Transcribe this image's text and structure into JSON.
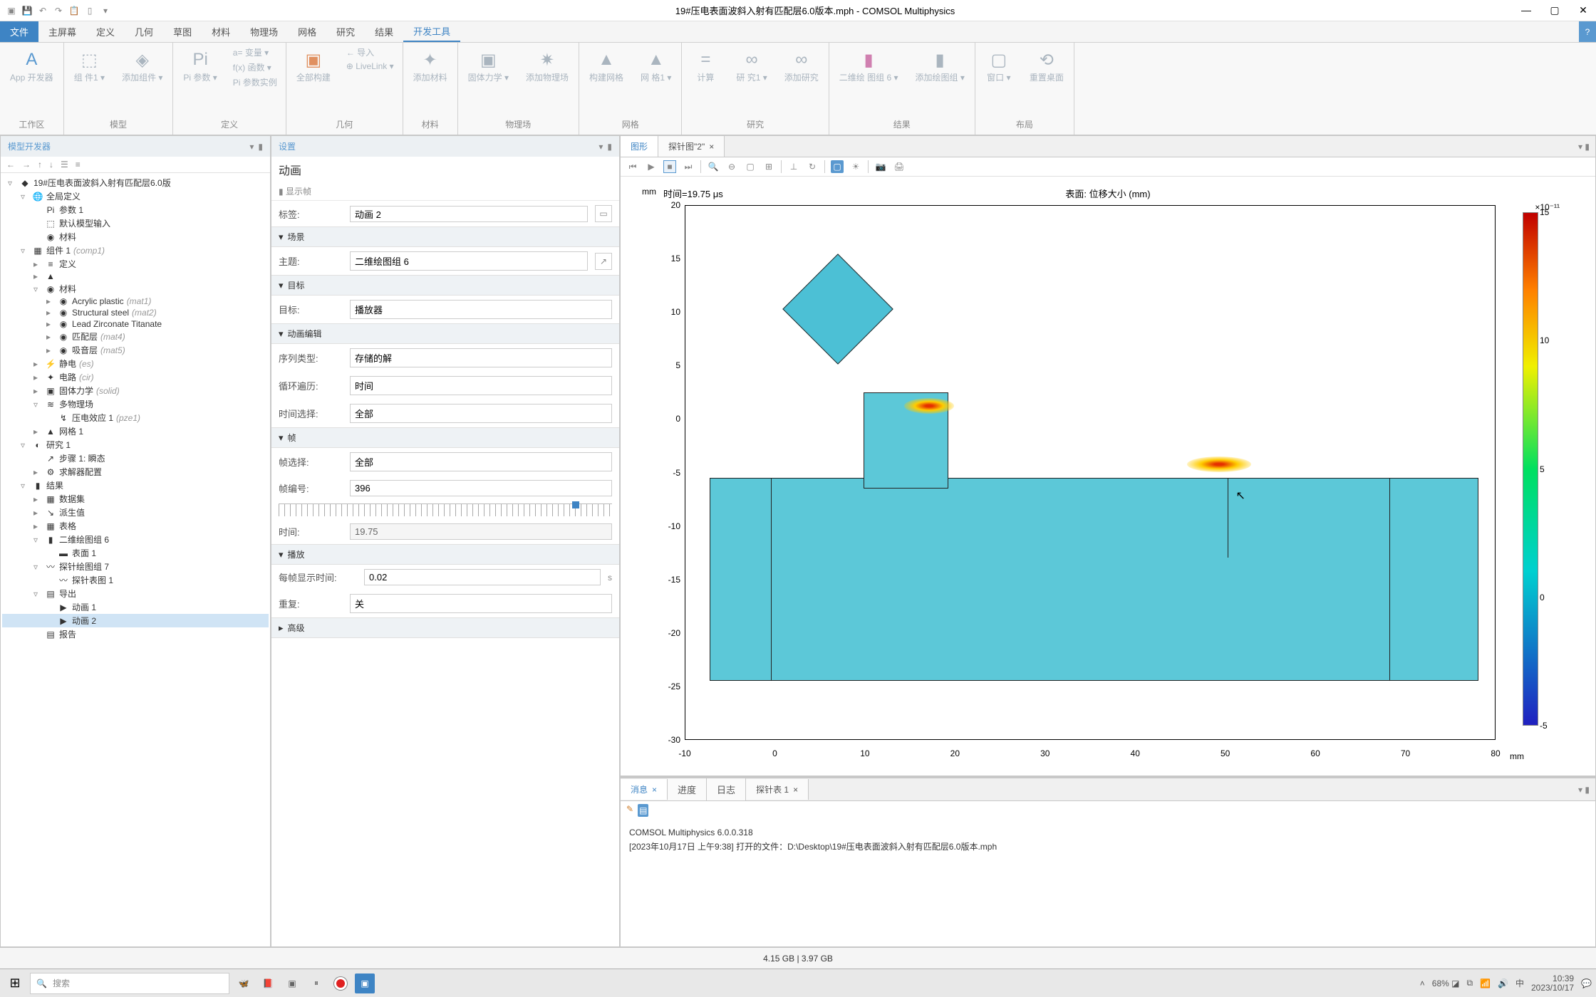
{
  "window": {
    "title": "19#压电表面波斜入射有匹配层6.0版本.mph - COMSOL Multiphysics"
  },
  "menu": {
    "file": "文件",
    "home": "主屏幕",
    "def": "定义",
    "geom": "几何",
    "sketch": "草图",
    "mat": "材料",
    "phys": "物理场",
    "mesh": "网格",
    "study": "研究",
    "result": "结果",
    "dev": "开发工具"
  },
  "ribbon_groups": {
    "workspace": "工作区",
    "model": "模型",
    "define": "定义",
    "geom": "几何",
    "material": "材料",
    "physics": "物理场",
    "mesh": "网格",
    "study": "研究",
    "result": "结果",
    "layout": "布局"
  },
  "ribbon": {
    "app": "App\n开发器",
    "component": "组\n件1 ▾",
    "add_comp": "添加组件\n▾",
    "param": "Pi\n参数\n▾",
    "var_stack": {
      "a": "a= 变量 ▾",
      "b": "f(x) 函数 ▾",
      "c": "Pi 参数实例"
    },
    "all_build": "全部构建",
    "geom_stack": {
      "a": "← 导入",
      "b": "⊕ LiveLink ▾"
    },
    "add_mat": "添加材料",
    "solid": "固体力学\n▾",
    "add_phys": "添加物理场",
    "build_mesh": "构建网格",
    "mesh": "网\n格1 ▾",
    "compute": "计算",
    "study_btn": "研\n究1 ▾",
    "add_study": "添加研究",
    "plot2d": "二维绘\n图组 6 ▾",
    "add_plot": "添加绘图组\n▾",
    "win": "窗口\n▾",
    "reset": "重置桌面"
  },
  "tree": {
    "header": "模型开发器",
    "items": [
      {
        "d": 0,
        "a": "▿",
        "i": "◆",
        "t": "19#压电表面波斜入射有匹配层6.0版"
      },
      {
        "d": 1,
        "a": "▿",
        "i": "🌐",
        "t": "全局定义"
      },
      {
        "d": 2,
        "a": "",
        "i": "Pi",
        "t": "参数 1"
      },
      {
        "d": 2,
        "a": "",
        "i": "⬚",
        "t": "默认模型输入"
      },
      {
        "d": 2,
        "a": "",
        "i": "◉",
        "t": "材料"
      },
      {
        "d": 1,
        "a": "▿",
        "i": "▦",
        "t": "组件 1",
        "h": "(comp1)"
      },
      {
        "d": 2,
        "a": "▸",
        "i": "≡",
        "t": "定义"
      },
      {
        "d": 2,
        "a": "▸",
        "i": "▲",
        "t": ""
      },
      {
        "d": 2,
        "a": "▿",
        "i": "◉",
        "t": "材料"
      },
      {
        "d": 3,
        "a": "▸",
        "i": "◉",
        "t": "Acrylic plastic",
        "h": "(mat1)"
      },
      {
        "d": 3,
        "a": "▸",
        "i": "◉",
        "t": "Structural steel",
        "h": "(mat2)"
      },
      {
        "d": 3,
        "a": "▸",
        "i": "◉",
        "t": "Lead Zirconate Titanate"
      },
      {
        "d": 3,
        "a": "▸",
        "i": "◉",
        "t": "匹配层",
        "h": "(mat4)"
      },
      {
        "d": 3,
        "a": "▸",
        "i": "◉",
        "t": "吸音层",
        "h": "(mat5)"
      },
      {
        "d": 2,
        "a": "▸",
        "i": "⚡",
        "t": "静电",
        "h": "(es)"
      },
      {
        "d": 2,
        "a": "▸",
        "i": "✦",
        "t": "电路",
        "h": "(cir)"
      },
      {
        "d": 2,
        "a": "▸",
        "i": "▣",
        "t": "固体力学",
        "h": "(solid)"
      },
      {
        "d": 2,
        "a": "▿",
        "i": "≋",
        "t": "多物理场"
      },
      {
        "d": 3,
        "a": "",
        "i": "↯",
        "t": "压电效应 1",
        "h": "(pze1)"
      },
      {
        "d": 2,
        "a": "▸",
        "i": "▲",
        "t": "网格 1"
      },
      {
        "d": 1,
        "a": "▿",
        "i": "◐",
        "t": "研究 1"
      },
      {
        "d": 2,
        "a": "",
        "i": "↗",
        "t": "步骤 1: 瞬态"
      },
      {
        "d": 2,
        "a": "▸",
        "i": "⚙",
        "t": "求解器配置"
      },
      {
        "d": 1,
        "a": "▿",
        "i": "▮",
        "t": "结果"
      },
      {
        "d": 2,
        "a": "▸",
        "i": "▦",
        "t": "数据集"
      },
      {
        "d": 2,
        "a": "▸",
        "i": "↘",
        "t": "派生值"
      },
      {
        "d": 2,
        "a": "▸",
        "i": "▦",
        "t": "表格"
      },
      {
        "d": 2,
        "a": "▿",
        "i": "▮",
        "t": "二维绘图组 6"
      },
      {
        "d": 3,
        "a": "",
        "i": "▬",
        "t": "表面 1"
      },
      {
        "d": 2,
        "a": "▿",
        "i": "〰",
        "t": "探针绘图组 7"
      },
      {
        "d": 3,
        "a": "",
        "i": "〰",
        "t": "探针表图 1"
      },
      {
        "d": 2,
        "a": "▿",
        "i": "▤",
        "t": "导出"
      },
      {
        "d": 3,
        "a": "",
        "i": "▶",
        "t": "动画 1"
      },
      {
        "d": 3,
        "a": "",
        "i": "▶",
        "t": "动画 2",
        "sel": true
      },
      {
        "d": 2,
        "a": "",
        "i": "▤",
        "t": "报告"
      }
    ]
  },
  "settings": {
    "header": "设置",
    "title": "动画",
    "show_frame": "显示帧",
    "label": {
      "k": "标签:",
      "v": "动画 2"
    },
    "sec_scene": "场景",
    "theme": {
      "k": "主题:",
      "v": "二维绘图组 6"
    },
    "sec_target": "目标",
    "target": {
      "k": "目标:",
      "v": "播放器"
    },
    "sec_anim": "动画编辑",
    "seq": {
      "k": "序列类型:",
      "v": "存储的解"
    },
    "loop": {
      "k": "循环遍历:",
      "v": "时间"
    },
    "tsel": {
      "k": "时间选择:",
      "v": "全部"
    },
    "sec_frame": "帧",
    "fsel": {
      "k": "帧选择:",
      "v": "全部"
    },
    "fnum": {
      "k": "帧编号:",
      "v": "396"
    },
    "time": {
      "k": "时间:",
      "v": "19.75"
    },
    "sec_play": "播放",
    "ftime": {
      "k": "每帧显示时间:",
      "v": "0.02",
      "u": "s"
    },
    "repeat": {
      "k": "重复:",
      "v": "关"
    },
    "sec_adv": "高级"
  },
  "graphics": {
    "tab1": "图形",
    "tab2": "探针图\"2\"",
    "time_label": "时间=19.75 μs",
    "plot_title": "表面: 位移大小 (mm)",
    "yunit": "mm",
    "xunit": "mm",
    "cbexp": "×10⁻¹¹",
    "yticks": [
      "20",
      "15",
      "10",
      "5",
      "0",
      "-5",
      "-10",
      "-15",
      "-20",
      "-25",
      "-30"
    ],
    "xticks": [
      "-10",
      "0",
      "10",
      "20",
      "30",
      "40",
      "50",
      "60",
      "70",
      "80"
    ],
    "cbticks": [
      "15",
      "10",
      "5",
      "0",
      "-5"
    ]
  },
  "messages": {
    "tabs": {
      "msg": "消息",
      "prog": "进度",
      "log": "日志",
      "probe": "探针表 1"
    },
    "line1": "COMSOL Multiphysics 6.0.0.318",
    "line2": "[2023年10月17日 上午9:38] 打开的文件：D:\\Desktop\\19#压电表面波斜入射有匹配层6.0版本.mph"
  },
  "status": "4.15 GB | 3.97 GB",
  "taskbar": {
    "search": "搜索",
    "battery": "68%",
    "ime": "中",
    "time": "10:39",
    "date": "2023/10/17"
  }
}
